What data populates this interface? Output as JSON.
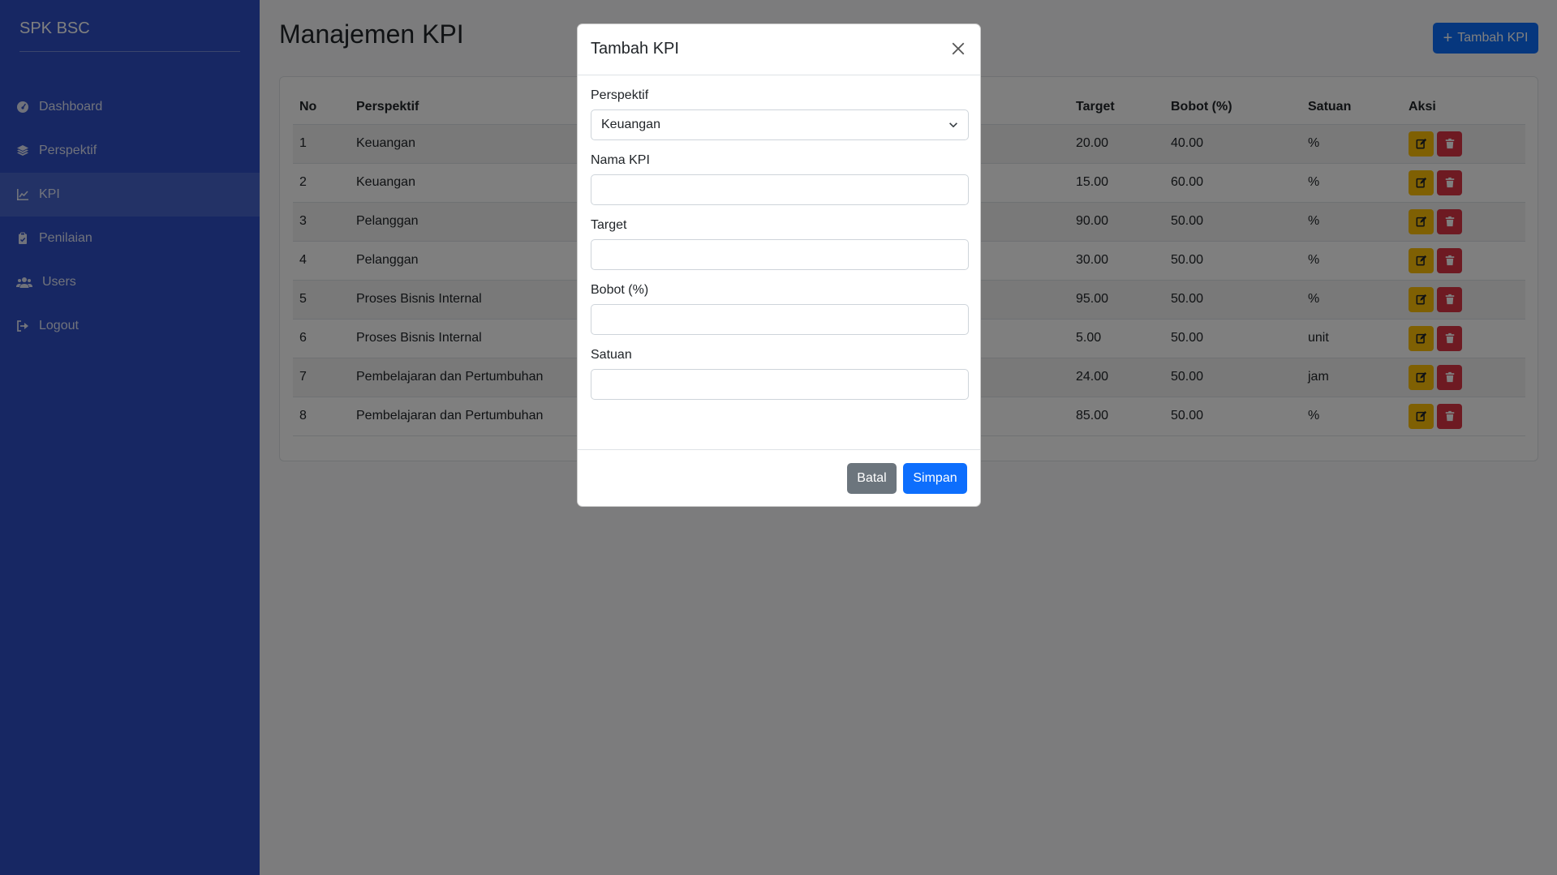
{
  "sidebar": {
    "brand": "SPK BSC",
    "items": [
      {
        "label": "Dashboard",
        "icon": "dashboard-icon"
      },
      {
        "label": "Perspektif",
        "icon": "layers-icon"
      },
      {
        "label": "KPI",
        "icon": "chart-line-icon"
      },
      {
        "label": "Penilaian",
        "icon": "clipboard-icon"
      },
      {
        "label": "Users",
        "icon": "users-icon"
      },
      {
        "label": "Logout",
        "icon": "logout-icon"
      }
    ],
    "active_item": "KPI"
  },
  "main": {
    "title": "Manajemen KPI",
    "add_button": "Tambah KPI"
  },
  "table": {
    "headers": {
      "no": "No",
      "perspektif": "Perspektif",
      "target": "Target",
      "bobot": "Bobot (%)",
      "satuan": "Satuan",
      "aksi": "Aksi"
    },
    "rows": [
      {
        "no": "1",
        "perspektif": "Keuangan",
        "target": "20.00",
        "bobot": "40.00",
        "satuan": "%"
      },
      {
        "no": "2",
        "perspektif": "Keuangan",
        "target": "15.00",
        "bobot": "60.00",
        "satuan": "%"
      },
      {
        "no": "3",
        "perspektif": "Pelanggan",
        "target": "90.00",
        "bobot": "50.00",
        "satuan": "%"
      },
      {
        "no": "4",
        "perspektif": "Pelanggan",
        "target": "30.00",
        "bobot": "50.00",
        "satuan": "%"
      },
      {
        "no": "5",
        "perspektif": "Proses Bisnis Internal",
        "target": "95.00",
        "bobot": "50.00",
        "satuan": "%"
      },
      {
        "no": "6",
        "perspektif": "Proses Bisnis Internal",
        "target": "5.00",
        "bobot": "50.00",
        "satuan": "unit"
      },
      {
        "no": "7",
        "perspektif": "Pembelajaran dan Pertumbuhan",
        "target": "24.00",
        "bobot": "50.00",
        "satuan": "jam"
      },
      {
        "no": "8",
        "perspektif": "Pembelajaran dan Pertumbuhan",
        "target": "85.00",
        "bobot": "50.00",
        "satuan": "%"
      }
    ]
  },
  "modal": {
    "title": "Tambah KPI",
    "fields": {
      "perspektif_label": "Perspektif",
      "perspektif_value": "Keuangan",
      "nama_label": "Nama KPI",
      "nama_value": "",
      "target_label": "Target",
      "target_value": "",
      "bobot_label": "Bobot (%)",
      "bobot_value": "",
      "satuan_label": "Satuan",
      "satuan_value": ""
    },
    "cancel_label": "Batal",
    "save_label": "Simpan"
  },
  "colors": {
    "sidebar_bg": "#2e4fc7",
    "primary": "#0d6efd",
    "warning": "#ffc107",
    "danger": "#dc3545",
    "secondary": "#6c757d"
  }
}
